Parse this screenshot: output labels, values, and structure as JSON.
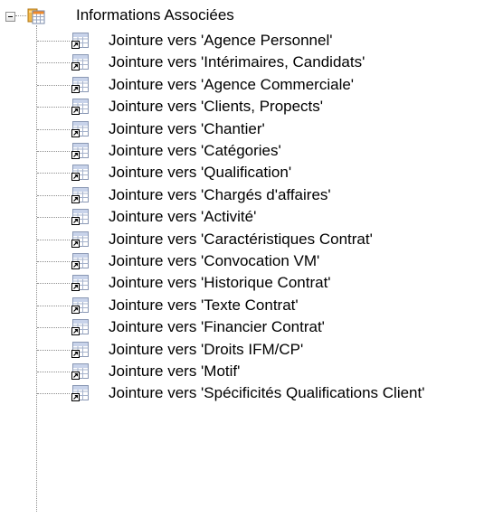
{
  "tree": {
    "root": {
      "label": "Informations Associées",
      "icon": "folder-table-icon",
      "expanded": true
    },
    "items": [
      {
        "label": "Jointure vers 'Agence Personnel'",
        "icon": "join-table-icon"
      },
      {
        "label": "Jointure vers 'Intérimaires, Candidats'",
        "icon": "join-table-icon"
      },
      {
        "label": "Jointure vers 'Agence Commerciale'",
        "icon": "join-table-icon"
      },
      {
        "label": "Jointure vers 'Clients, Propects'",
        "icon": "join-table-icon"
      },
      {
        "label": "Jointure vers 'Chantier'",
        "icon": "join-table-icon"
      },
      {
        "label": "Jointure vers 'Catégories'",
        "icon": "join-table-icon"
      },
      {
        "label": "Jointure vers 'Qualification'",
        "icon": "join-table-icon"
      },
      {
        "label": "Jointure vers 'Chargés d'affaires'",
        "icon": "join-table-icon"
      },
      {
        "label": "Jointure vers 'Activité'",
        "icon": "join-table-icon"
      },
      {
        "label": "Jointure vers 'Caractéristiques Contrat'",
        "icon": "join-table-icon"
      },
      {
        "label": "Jointure vers 'Convocation VM'",
        "icon": "join-table-icon"
      },
      {
        "label": "Jointure vers 'Historique Contrat'",
        "icon": "join-table-icon"
      },
      {
        "label": "Jointure vers 'Texte Contrat'",
        "icon": "join-table-icon"
      },
      {
        "label": "Jointure vers 'Financier Contrat'",
        "icon": "join-table-icon"
      },
      {
        "label": "Jointure vers 'Droits IFM/CP'",
        "icon": "join-table-icon"
      },
      {
        "label": "Jointure vers 'Motif'",
        "icon": "join-table-icon"
      },
      {
        "label": "Jointure vers 'Spécificités Qualifications Client'",
        "icon": "join-table-icon"
      }
    ]
  }
}
